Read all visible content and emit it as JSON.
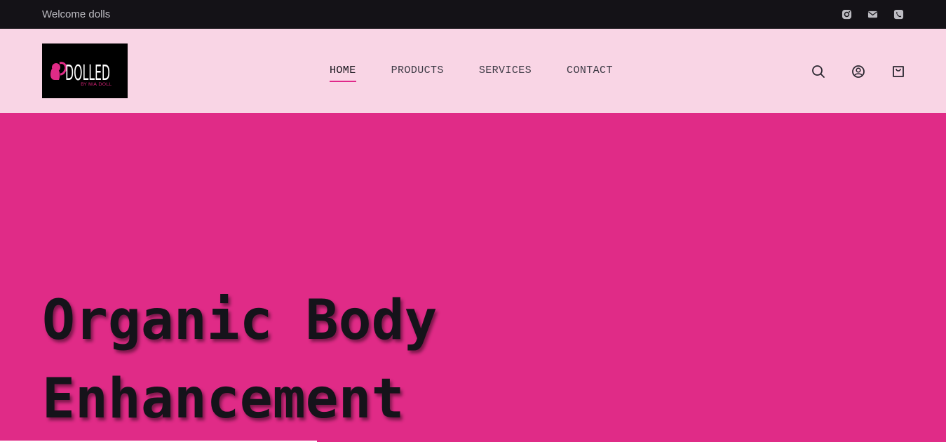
{
  "topbar": {
    "welcome": "Welcome dolls",
    "icons": [
      "instagram-icon",
      "email-icon",
      "phone-icon"
    ]
  },
  "header": {
    "logo": {
      "main": "DOLLED",
      "sub": "BY NIA DOLL"
    },
    "nav": [
      {
        "label": "HOME",
        "active": true
      },
      {
        "label": "PRODUCTS",
        "active": false
      },
      {
        "label": "SERVICES",
        "active": false
      },
      {
        "label": "CONTACT",
        "active": false
      }
    ],
    "icons": [
      "search-icon",
      "account-icon",
      "cart-icon"
    ]
  },
  "hero": {
    "title_line1": "Organic Body",
    "title_line2": "Enhancement"
  },
  "colors": {
    "topbar_bg": "#141217",
    "header_bg": "#f9d5e5",
    "hero_bg": "#e02b87",
    "accent": "#e0288a",
    "text_dark": "#15131a"
  }
}
